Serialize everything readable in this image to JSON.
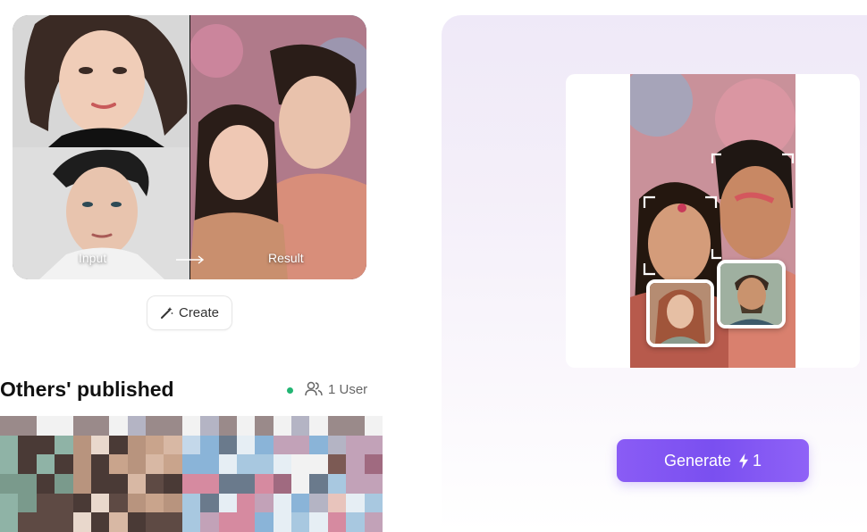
{
  "example": {
    "input_label": "Input",
    "result_label": "Result"
  },
  "create_button": {
    "label": "Create"
  },
  "published": {
    "title": "Others' published",
    "users_count": "1 User",
    "online_color": "#22b573"
  },
  "generate_button": {
    "label": "Generate",
    "cost": "1",
    "color": "#7a4ff0"
  },
  "icons": {
    "create": "magic-wand-icon",
    "users": "users-icon",
    "generate": "lightning-icon",
    "arrow": "arrow-right-icon"
  }
}
